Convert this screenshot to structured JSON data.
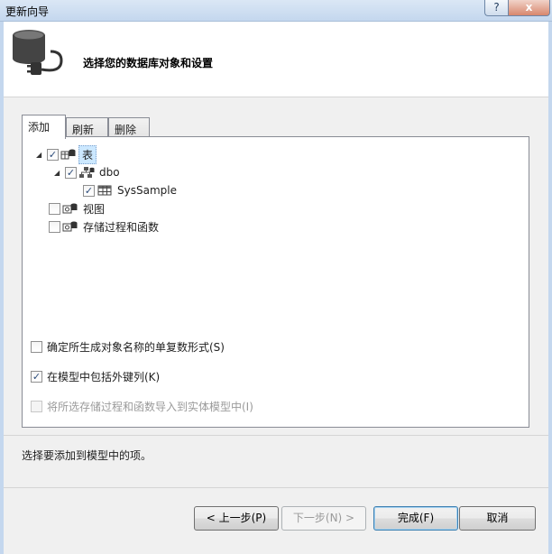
{
  "window": {
    "title": "更新向导",
    "help_button": "?",
    "close_button": "x"
  },
  "header": {
    "title": "选择您的数据库对象和设置"
  },
  "tabs": [
    {
      "label": "添加"
    },
    {
      "label": "刷新"
    },
    {
      "label": "删除"
    }
  ],
  "tree": {
    "tables": {
      "label": "表",
      "checked": true
    },
    "dbo": {
      "label": "dbo",
      "checked": true
    },
    "sys_sample": {
      "label": "SysSample",
      "checked": true
    },
    "views": {
      "label": "视图",
      "checked": false
    },
    "procedures": {
      "label": "存储过程和函数",
      "checked": false
    }
  },
  "options": {
    "pluralize": {
      "label": "确定所生成对象名称的单复数形式(S)",
      "checked": false
    },
    "include_fk": {
      "label": "在模型中包括外键列(K)",
      "checked": true
    },
    "import_procs": {
      "label": "将所选存储过程和函数导入到实体模型中(I)",
      "checked": false,
      "enabled": false
    }
  },
  "status": "选择要添加到模型中的项。",
  "buttons": {
    "prev": "< 上一步(P)",
    "next": "下一步(N) >",
    "finish": "完成(F)",
    "cancel": "取消"
  }
}
